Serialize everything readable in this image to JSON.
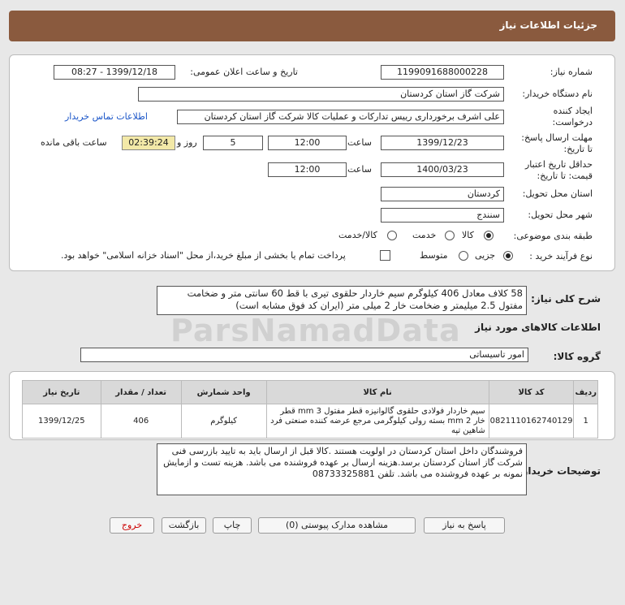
{
  "header": {
    "title": "جزئیات اطلاعات نیاز"
  },
  "form": {
    "need_number_label": "شماره نیاز:",
    "need_number": "1199091688000228",
    "announce_label": "تاریخ و ساعت اعلان عمومی:",
    "announce_value": "1399/12/18 - 08:27",
    "buyer_org_label": "نام دستگاه خریدار:",
    "buyer_org": "شرکت گاز استان کردستان",
    "creator_label_1": "ایجاد کننده",
    "creator_label_2": "درخواست:",
    "creator": "علی اشرف برخورداری رییس تدارکات و عملیات کالا شرکت گاز استان کردستان",
    "contact_link": "اطلاعات تماس خریدار",
    "reply_label_1": "مهلت ارسال پاسخ:",
    "reply_label_2": "تا تاریخ:",
    "reply_date": "1399/12/23",
    "time_label": "ساعت",
    "reply_time": "12:00",
    "days_value": "5",
    "days_label": "روز و",
    "remaining_time": "02:39:24",
    "remaining_label": "ساعت باقی مانده",
    "validity_label_1": "حداقل تاریخ اعتبار",
    "validity_label_2": "قیمت: تا تاریخ:",
    "validity_date": "1400/03/23",
    "validity_time": "12:00",
    "province_label": "استان محل تحویل:",
    "province": "کردستان",
    "city_label": "شهر محل تحویل:",
    "city": "سنندج",
    "category_label": "طبقه بندی موضوعی:",
    "category_options": [
      "کالا",
      "خدمت",
      "کالا/خدمت"
    ],
    "process_label": "نوع فرآیند خرید :",
    "process_options": [
      "جزیی",
      "متوسط"
    ],
    "payment_note": "پرداخت تمام یا بخشی از مبلغ خرید،از محل \"اسناد خزانه اسلامی\" خواهد بود."
  },
  "summary": {
    "label": "شرح کلی نیاز:",
    "text": "58 کلاف معادل 406 کیلوگرم سیم خاردار حلقوی تیری با قط 60 سانتی متر و ضخامت مفتول 2.5 میلیمتر و ضخامت خار 2 میلی متر (ایران کد فوق مشابه است)"
  },
  "goods": {
    "section_title": "اطلاعات کالاهای مورد نیاز",
    "group_label": "گروه کالا:",
    "group_value": "امور تاسیساتی",
    "columns": [
      "ردیف",
      "کد کالا",
      "نام کالا",
      "واحد شمارش",
      "تعداد / مقدار",
      "تاریخ نیاز"
    ],
    "rows": [
      {
        "index": "1",
        "code": "0821110162740129",
        "name": "سیم خاردار فولادی حلقوی گالوانیزه قطر مفتول 3 mm قطر خار 2 mm بسته رولی کیلوگرمی مرجع عرضه کننده صنعتی فرد شاهین تپه",
        "unit": "کیلوگرم",
        "qty": "406",
        "date": "1399/12/25"
      }
    ]
  },
  "buyer_notes": {
    "label": "توضیحات خریدار:",
    "text": "فروشندگان داخل استان کردستان در اولویت هستند .کالا قبل از ارسال باید به تایید بازرسی فنی شرکت گاز استان کردستان برسد.هزینه ارسال بر عهده فروشنده می باشد. هزینه تست و ازمایش نمونه بر عهده فروشنده می باشد. تلفن 08733325881"
  },
  "buttons": {
    "reply": "پاسخ به نیاز",
    "attachments": "مشاهده مدارک پیوستی (0)",
    "print": "چاپ",
    "back": "بازگشت",
    "exit": "خروج"
  },
  "watermark": "ParsNamadData"
}
